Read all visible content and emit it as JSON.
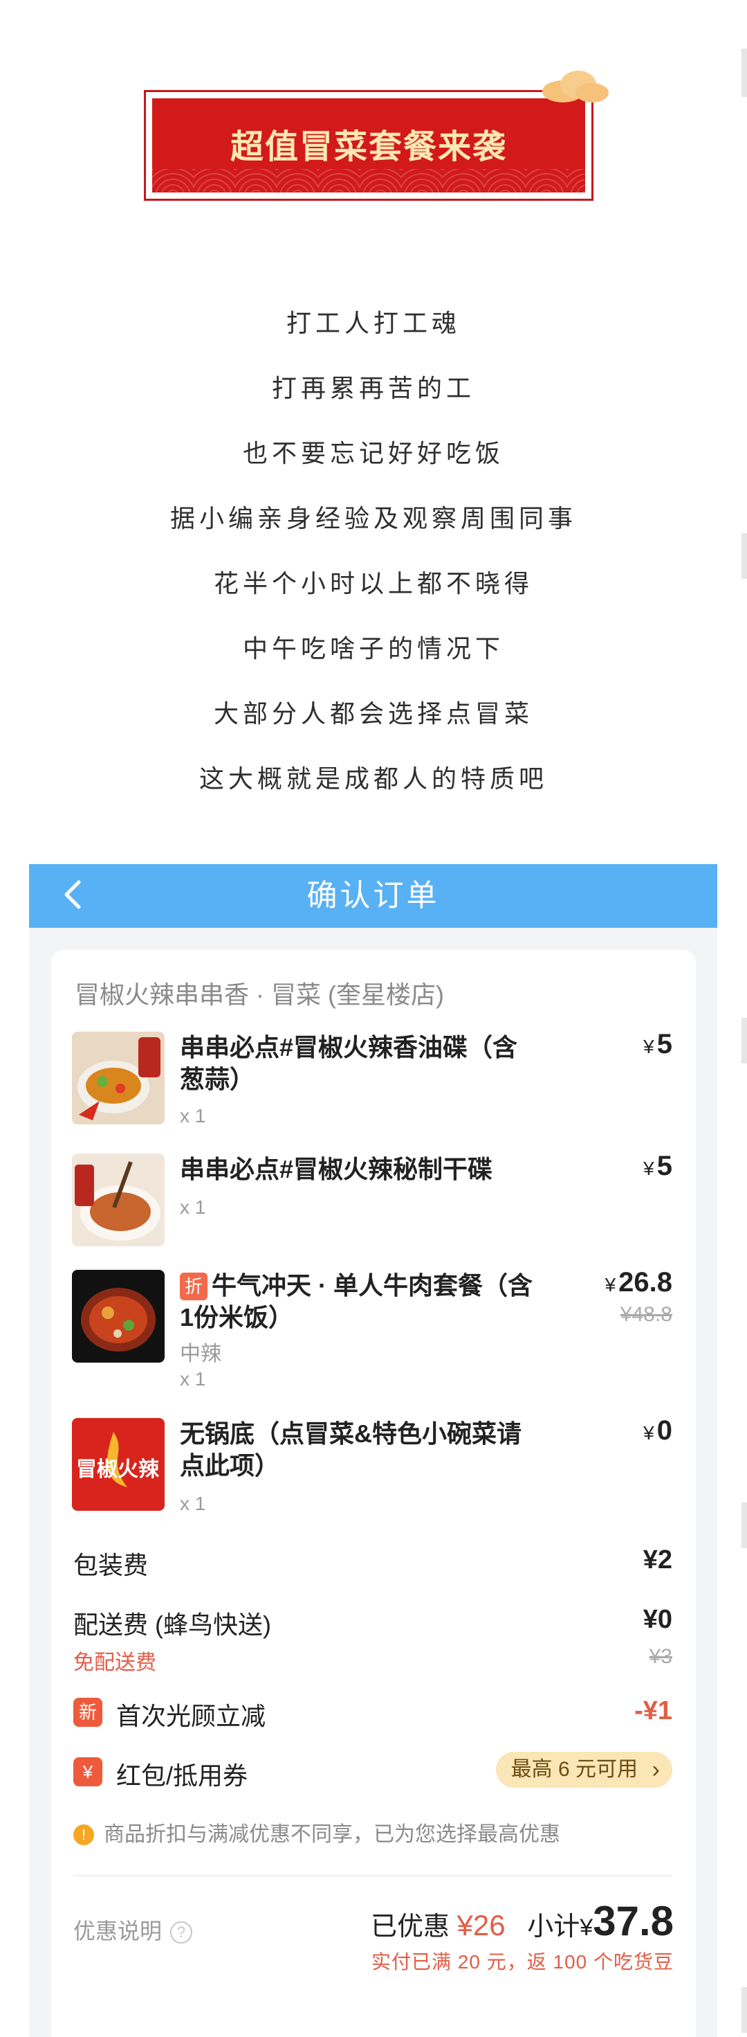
{
  "banner": {
    "title": "超值冒菜套餐来袭"
  },
  "intro_lines": [
    "打工人打工魂",
    "打再累再苦的工",
    "也不要忘记好好吃饭",
    "据小编亲身经验及观察周围同事",
    "花半个小时以上都不晓得",
    "中午吃啥子的情况下",
    "大部分人都会选择点冒菜",
    "这大概就是成都人的特质吧"
  ],
  "header": {
    "title": "确认订单"
  },
  "shop": {
    "name": "冒椒火辣串串香 · 冒菜 (奎星楼店)"
  },
  "items": [
    {
      "name": "串串必点#冒椒火辣香油碟（含葱蒜）",
      "qty": "x 1",
      "price": "5",
      "currency": "¥"
    },
    {
      "name": "串串必点#冒椒火辣秘制干碟",
      "qty": "x 1",
      "price": "5",
      "currency": "¥"
    },
    {
      "badge": "折",
      "name": "牛气冲天 · 单人牛肉套餐（含1份米饭）",
      "spec": "中辣",
      "qty": "x 1",
      "price": "26.8",
      "old_price": "¥48.8",
      "currency": "¥"
    },
    {
      "name": "无锅底（点冒菜&特色小碗菜请点此项）",
      "qty": "x 1",
      "price": "0",
      "currency": "¥",
      "thumb_text": "冒椒火辣"
    }
  ],
  "fees": {
    "packaging_label": "包装费",
    "packaging_value": "¥2",
    "delivery_label": "配送费 (蜂鸟快送)",
    "delivery_value": "¥0",
    "free_delivery": "免配送费",
    "delivery_old": "¥3"
  },
  "promos": {
    "first_badge": "新",
    "first_label": "首次光顾立减",
    "first_value": "-¥1",
    "coupon_badge": "¥",
    "coupon_label": "红包/抵用券",
    "coupon_button": "最高 6 元可用"
  },
  "notice": "商品折扣与满减优惠不同享，已为您选择最高优惠",
  "footer": {
    "promo_info": "优惠说明",
    "discounted_label": "已优惠",
    "discounted_value": "¥26",
    "subtotal_label": "小计",
    "currency": "¥",
    "subtotal": "37.8",
    "cashback": "实付已满 20 元，返 100 个吃货豆"
  },
  "colors": {
    "header_bg": "#58b1f4",
    "accent_red": "#e35c46",
    "banner_red": "#d21a1a"
  }
}
